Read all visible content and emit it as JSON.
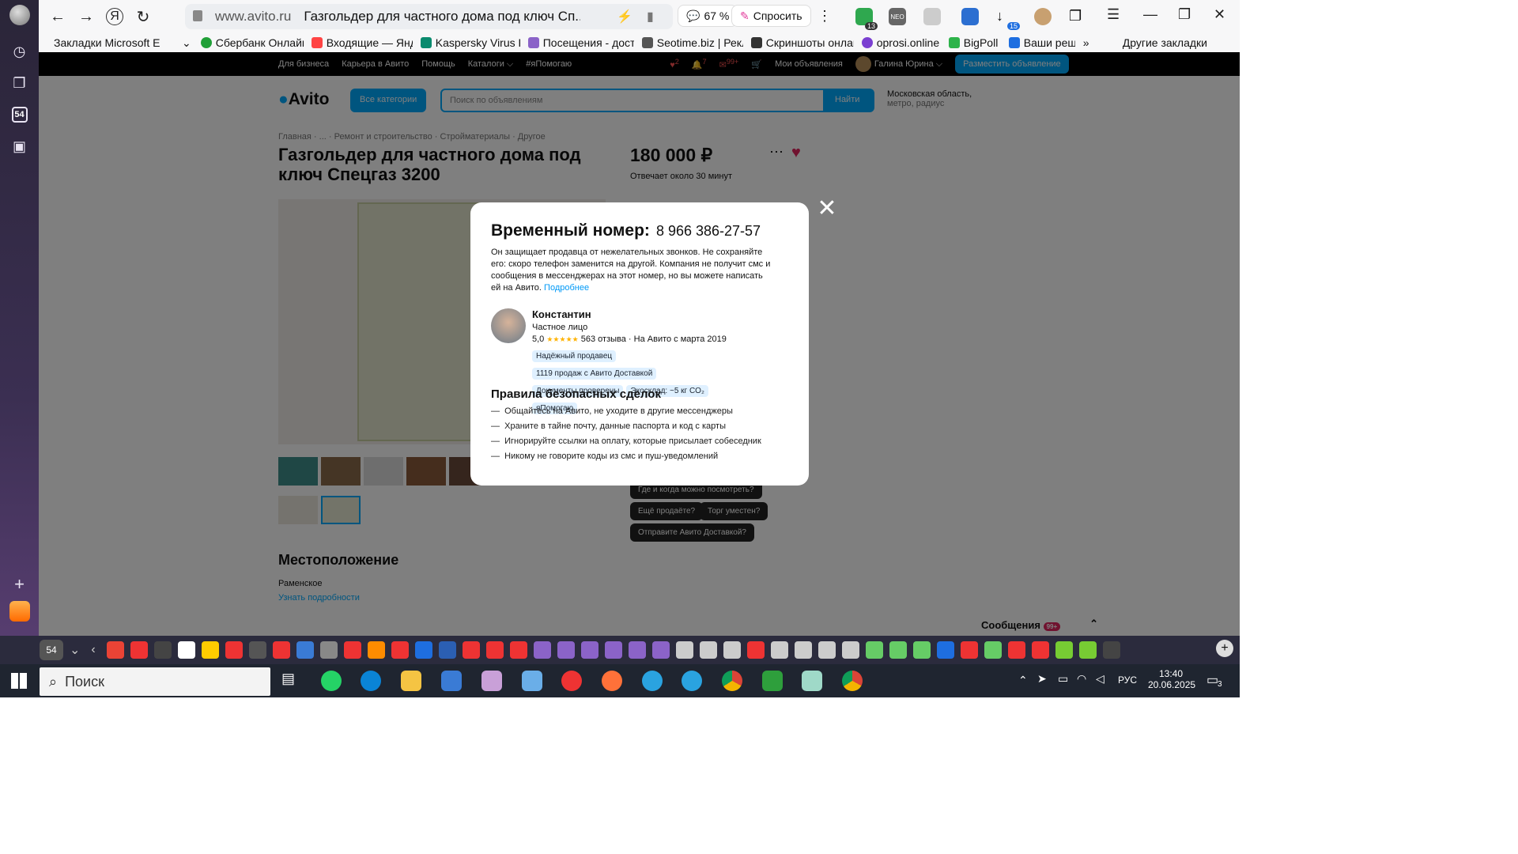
{
  "browser": {
    "domain": "www.avito.ru",
    "tab_title": "Газгольдер для частного дома под ключ Сп...",
    "zoom": "67 %",
    "ask_label": "Спросить",
    "ext_badges": {
      "a": "13",
      "b": "15"
    },
    "sidebar_badge": "54"
  },
  "bookmarks": [
    "Закладки Microsoft E",
    "Сбербанк Онлайн",
    "Входящие — Яндек",
    "Kaspersky Virus Re",
    "Посещения - дост",
    "Seotime.biz | Рекл",
    "Скриншоты онлай",
    "oprosi.online",
    "BigPoll",
    "Ваши реш",
    "»",
    "Другие закладки"
  ],
  "avito": {
    "top_links": [
      "Для бизнеса",
      "Карьера в Авито",
      "Помощь",
      "Каталоги ⌵",
      "#яПомогаю"
    ],
    "counters": [
      "2",
      "7",
      "99+"
    ],
    "my_ads": "Мои объявления",
    "user": "Галина Юрина ⌵",
    "place_ad": "Разместить объявление",
    "logo": "Avito",
    "all_categories": "Все категории",
    "search_placeholder": "Поиск по объявлениям",
    "find": "Найти",
    "location": "Московская область,",
    "location_sub": "метро, радиус",
    "breadcrumbs": "Главная · ... · Ремонт и строительство · Стройматериалы · Другое",
    "title": "Газгольдер для частного дома под ключ Спецгаз 3200",
    "price": "180 000 ₽",
    "reply_time": "Отвечает около 30 минут",
    "quick_questions": [
      "Где и когда можно посмотреть?",
      "Ещё продаёте?",
      "Торг уместен?",
      "Отправите Авито Доставкой?"
    ],
    "location_title": "Местоположение",
    "city": "Раменское",
    "details_link": "Узнать подробности",
    "messages": "Сообщения",
    "messages_badge": "99+"
  },
  "modal": {
    "heading": "Временный номер:",
    "phone": "8 966 386-27-57",
    "desc": "Он защищает продавца от нежелательных звонков. Не сохраняйте его: скоро телефон заменится на другой. Компания не получит смс и сообщения в мессенджерах на этот номер, но вы можете написать ей на Авито.",
    "more": "Подробнее",
    "seller": {
      "name": "Константин",
      "type": "Частное лицо",
      "rating": "5,0",
      "stars": "★★★★★",
      "reviews": "563 отзыва · На Авито с марта 2019"
    },
    "tags": [
      "Надёжный продавец",
      "1119 продаж с Авито Доставкой",
      "Документы проверены",
      "Экосклад: ~5 кг CO₂",
      "яПомогаю"
    ],
    "rules_title": "Правила безопасных сделок",
    "rules": [
      "Общайтесь на Авито, не уходите в другие мессенджеры",
      "Храните в тайне почту, данные паспорта и код с карты",
      "Игнорируйте ссылки на оплату, которые присылает собеседник",
      "Никому не говорите коды из смс и пуш-уведомлений"
    ]
  },
  "taskbar": {
    "search": "Поиск",
    "lang": "РУС",
    "time": "13:40",
    "date": "20.06.2025",
    "notif": "3",
    "strip_badge": "54"
  }
}
